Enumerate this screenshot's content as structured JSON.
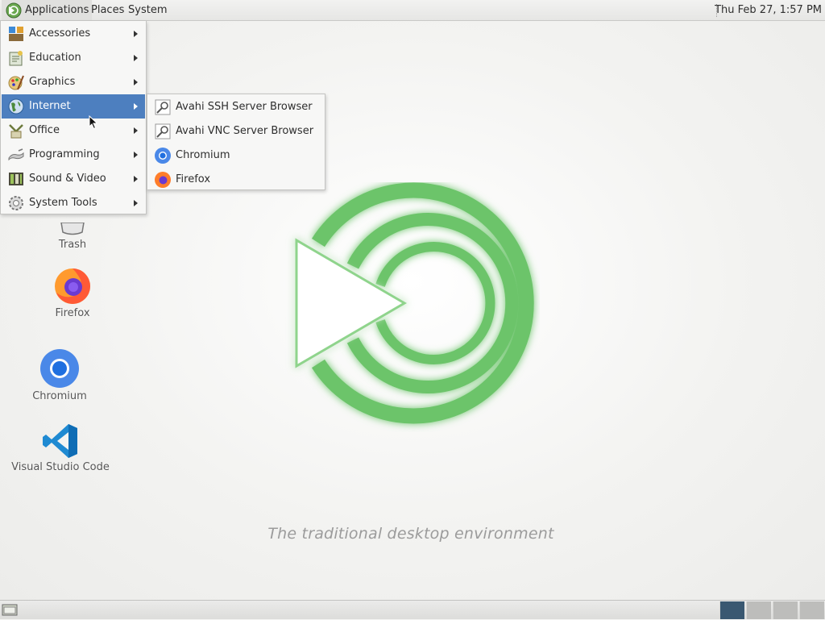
{
  "top_panel": {
    "menus": {
      "applications": "Applications",
      "places": "Places",
      "system": "System"
    },
    "clock": "Thu Feb 27,  1:57 PM"
  },
  "applications_menu": {
    "items": [
      {
        "label": "Accessories",
        "icon": "accessories-icon"
      },
      {
        "label": "Education",
        "icon": "education-icon"
      },
      {
        "label": "Graphics",
        "icon": "graphics-icon"
      },
      {
        "label": "Internet",
        "icon": "internet-icon",
        "highlighted": true
      },
      {
        "label": "Office",
        "icon": "office-icon"
      },
      {
        "label": "Programming",
        "icon": "programming-icon"
      },
      {
        "label": "Sound & Video",
        "icon": "sound-video-icon"
      },
      {
        "label": "System Tools",
        "icon": "system-tools-icon"
      }
    ]
  },
  "internet_submenu": {
    "items": [
      {
        "label": "Avahi SSH Server Browser",
        "icon": "network-search-icon"
      },
      {
        "label": "Avahi VNC Server Browser",
        "icon": "network-search-icon"
      },
      {
        "label": "Chromium",
        "icon": "chromium-icon"
      },
      {
        "label": "Firefox",
        "icon": "firefox-icon"
      }
    ]
  },
  "desktop": {
    "icons": [
      {
        "label": "Trash",
        "icon": "trash-icon"
      },
      {
        "label": "Firefox",
        "icon": "firefox-icon"
      },
      {
        "label": "Chromium",
        "icon": "chromium-icon"
      },
      {
        "label": "Visual Studio Code",
        "icon": "vscode-icon"
      }
    ],
    "tagline": "The traditional desktop environment"
  },
  "bottom_panel": {
    "workspaces": 4,
    "active_workspace": 1
  },
  "colors": {
    "menu_highlight": "#4d7fbf",
    "logo_green": "#6cc46a",
    "active_workspace": "#3a5871"
  }
}
